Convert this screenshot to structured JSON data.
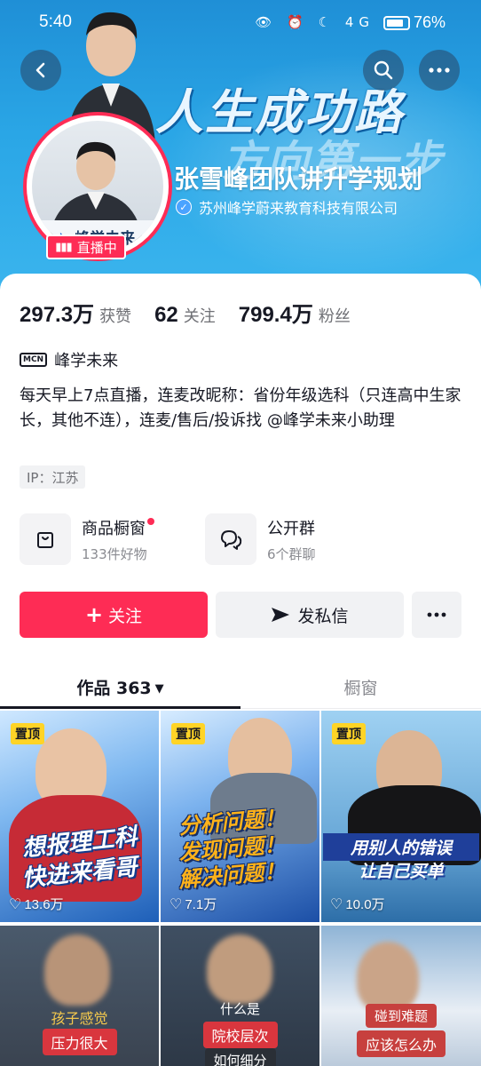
{
  "status_bar": {
    "time": "5:40",
    "icons": "👁 ⏰ ☾ 4G",
    "battery": "76%"
  },
  "banner": {
    "slogan_line1": "人生成功路",
    "slogan_line2": "方向第一步",
    "title": "张雪峰团队讲升学规划",
    "org": "苏州峰学蔚来教育科技有限公司",
    "avatar_logo": "峰学未来",
    "live_label": "直播中"
  },
  "stats": [
    {
      "value": "297.3万",
      "label": "获赞"
    },
    {
      "value": "62",
      "label": "关注"
    },
    {
      "value": "799.4万",
      "label": "粉丝"
    }
  ],
  "mcn": {
    "badge": "MCN",
    "name": "峰学未来"
  },
  "bio": "每天早上7点直播，连麦改昵称：省份年级选科（只连高中生家长，其他不连），连麦/售后/投诉找 @峰学未来小助理",
  "ip": "IP：江苏",
  "features": {
    "shop": {
      "title": "商品橱窗",
      "subtitle": "133件好物"
    },
    "group": {
      "title": "公开群",
      "subtitle": "6个群聊"
    }
  },
  "buttons": {
    "follow": "关注",
    "message": "发私信"
  },
  "tabs": {
    "works": "作品 363",
    "shop": "橱窗"
  },
  "videos": [
    {
      "pinned": "置顶",
      "caption1": "想报理工科",
      "caption2": "快进来看哥",
      "likes": "13.6万"
    },
    {
      "pinned": "置顶",
      "caption1": "分析问题！",
      "caption2": "发现问题！",
      "caption3": "解决问题！",
      "likes": "7.1万"
    },
    {
      "pinned": "置顶",
      "caption1": "用别人的错误",
      "caption2": "让自己买单",
      "likes": "10.0万"
    },
    {
      "label1": "孩子感觉",
      "label2": "压力很大"
    },
    {
      "label1": "什么是",
      "label2": "院校层次",
      "label3": "如何细分"
    },
    {
      "label1": "碰到难题",
      "label2": "应该怎么办"
    }
  ],
  "colors": {
    "accent": "#fe2c55",
    "banner": "#2aa6e6",
    "pin": "#ffd426"
  }
}
